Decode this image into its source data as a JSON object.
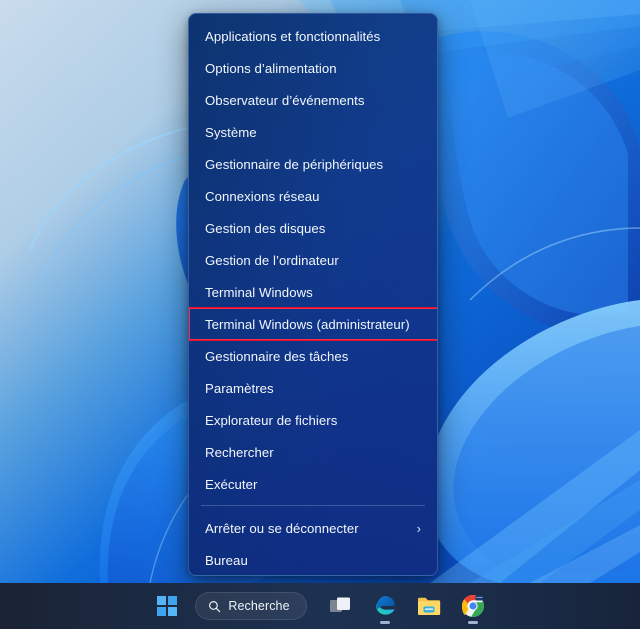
{
  "desktop": {
    "wallpaper_name": "windows-11-bloom-wallpaper",
    "accent_blue": "#0a62d0",
    "highlight_color": "#e8112d"
  },
  "context_menu": {
    "name": "win-x-power-user-menu",
    "groups": [
      {
        "items": [
          {
            "label": "Applications et fonctionnalités",
            "name": "menu-item-apps-features",
            "submenu": false,
            "highlighted": false
          },
          {
            "label": "Options d’alimentation",
            "name": "menu-item-power-options",
            "submenu": false,
            "highlighted": false
          },
          {
            "label": "Observateur d’événements",
            "name": "menu-item-event-viewer",
            "submenu": false,
            "highlighted": false
          },
          {
            "label": "Système",
            "name": "menu-item-system",
            "submenu": false,
            "highlighted": false
          },
          {
            "label": "Gestionnaire de périphériques",
            "name": "menu-item-device-manager",
            "submenu": false,
            "highlighted": false
          },
          {
            "label": "Connexions réseau",
            "name": "menu-item-network-connections",
            "submenu": false,
            "highlighted": false
          },
          {
            "label": "Gestion des disques",
            "name": "menu-item-disk-management",
            "submenu": false,
            "highlighted": false
          },
          {
            "label": "Gestion de l’ordinateur",
            "name": "menu-item-computer-management",
            "submenu": false,
            "highlighted": false
          },
          {
            "label": "Terminal Windows",
            "name": "menu-item-windows-terminal",
            "submenu": false,
            "highlighted": false
          },
          {
            "label": "Terminal Windows (administrateur)",
            "name": "menu-item-windows-terminal-admin",
            "submenu": false,
            "highlighted": true
          },
          {
            "label": "Gestionnaire des tâches",
            "name": "menu-item-task-manager",
            "submenu": false,
            "highlighted": false
          },
          {
            "label": "Paramètres",
            "name": "menu-item-settings",
            "submenu": false,
            "highlighted": false
          },
          {
            "label": "Explorateur de fichiers",
            "name": "menu-item-file-explorer",
            "submenu": false,
            "highlighted": false
          },
          {
            "label": "Rechercher",
            "name": "menu-item-search",
            "submenu": false,
            "highlighted": false
          },
          {
            "label": "Exécuter",
            "name": "menu-item-run",
            "submenu": false,
            "highlighted": false
          }
        ]
      },
      {
        "items": [
          {
            "label": "Arrêter ou se déconnecter",
            "name": "menu-item-shutdown-signout",
            "submenu": true,
            "highlighted": false
          },
          {
            "label": "Bureau",
            "name": "menu-item-desktop",
            "submenu": false,
            "highlighted": false
          }
        ]
      }
    ],
    "submenu_glyph": "›"
  },
  "taskbar": {
    "search": {
      "icon": "search-icon",
      "label": "Recherche",
      "placeholder": "Recherche"
    },
    "items": [
      {
        "name": "start-button",
        "icon": "windows-logo-icon",
        "label": "Démarrer",
        "running": false
      },
      {
        "name": "task-view-button",
        "icon": "task-view-icon",
        "label": "Affichage des tâches",
        "running": false
      },
      {
        "name": "edge-button",
        "icon": "microsoft-edge-icon",
        "label": "Microsoft Edge",
        "running": true
      },
      {
        "name": "file-explorer-button",
        "icon": "file-explorer-icon",
        "label": "Explorateur de fichiers",
        "running": false
      },
      {
        "name": "chrome-button",
        "icon": "google-chrome-icon",
        "label": "Google Chrome",
        "running": true
      }
    ]
  }
}
